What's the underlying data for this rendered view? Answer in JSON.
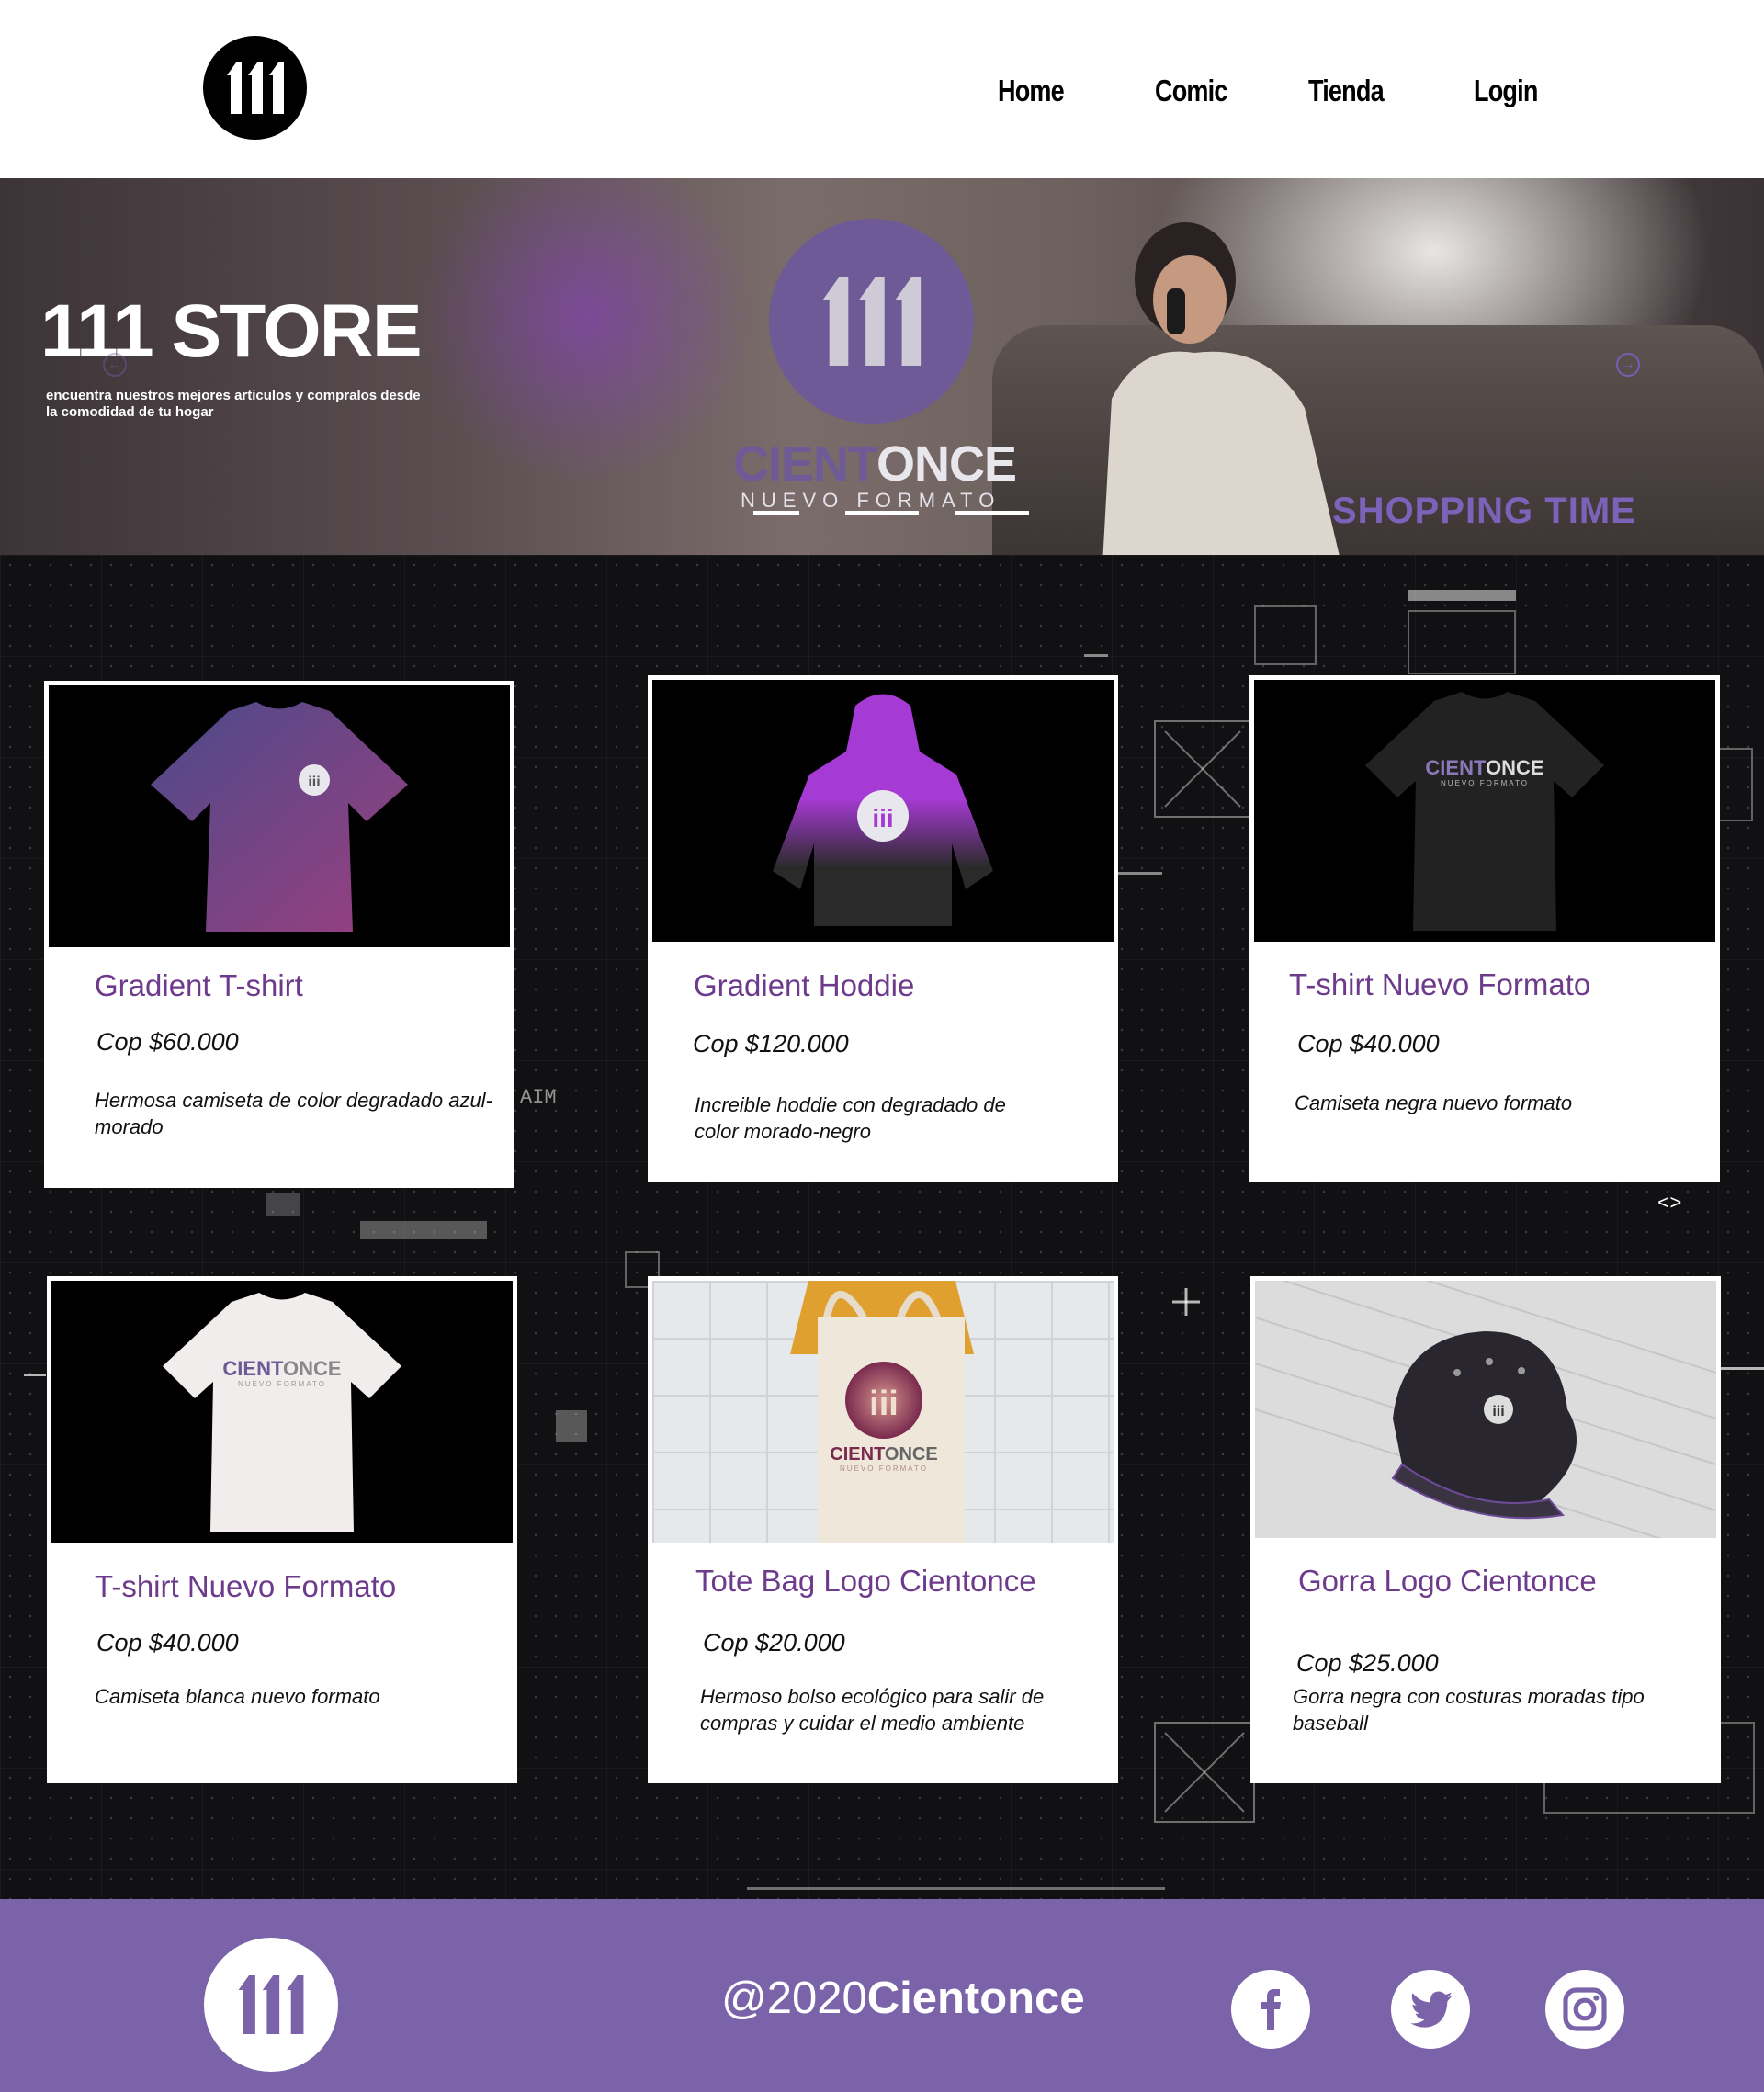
{
  "header": {
    "nav": [
      "Home",
      "Comic",
      "Tienda",
      "Login"
    ]
  },
  "hero": {
    "title": "111 STORE",
    "subtitle": "encuentra nuestros mejores articulos y compralos desde la comodidad de tu hogar",
    "brand_a": "CIENT",
    "brand_b": "ONCE",
    "tagline": "NUEVO FORMATO",
    "shopping": "SHOPPING TIME",
    "prev_arrow": "←",
    "next_arrow": "→"
  },
  "products": [
    {
      "title": "Gradient T-shirt",
      "price": "Cop $60.000",
      "description": "Hermosa camiseta de color degradado azul-morado"
    },
    {
      "title": "Gradient Hoddie",
      "price": "Cop $120.000",
      "description": "Increible hoddie con degradado de color morado-negro"
    },
    {
      "title": "T-shirt Nuevo Formato",
      "price": "Cop $40.000",
      "description": "Camiseta negra nuevo formato"
    },
    {
      "title": "T-shirt Nuevo Formato",
      "price": "Cop $40.000",
      "description": "Camiseta blanca nuevo formato"
    },
    {
      "title": "Tote Bag Logo Cientonce",
      "price": "Cop $20.000",
      "description": "Hermoso bolso ecológico para salir de compras y cuidar el medio ambiente"
    },
    {
      "title": "Gorra Logo Cientonce",
      "price": "Cop $25.000",
      "description": "Gorra negra con costuras moradas tipo baseball"
    }
  ],
  "product_print": {
    "brand_a": "CIENT",
    "brand_b": "ONCE",
    "tagline": "NUEVO FORMATO"
  },
  "deco": {
    "aim": "AIM",
    "code": "<>"
  },
  "footer": {
    "copyright_a": "@2020",
    "copyright_b": "Cientonce",
    "social": [
      "facebook-icon",
      "twitter-icon",
      "instagram-icon"
    ]
  },
  "colors": {
    "accent": "#7a63a9",
    "title": "#6e3a8c",
    "brand": "#6d5a97"
  }
}
